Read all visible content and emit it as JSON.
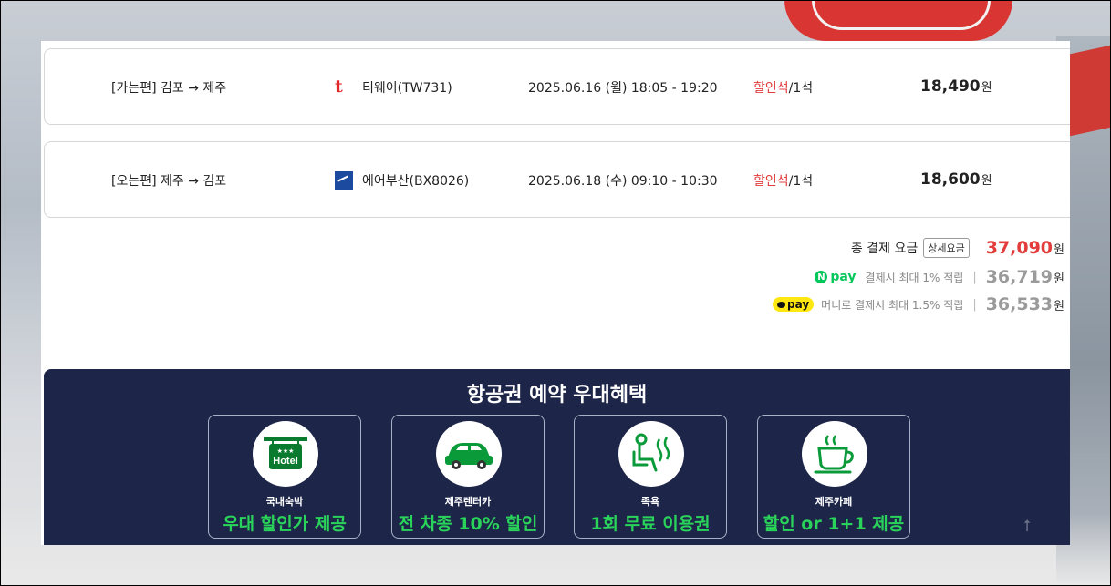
{
  "flights": [
    {
      "route": "[가는편] 김포 → 제주",
      "airline_logo": "tway-logo-icon",
      "airline_logo_text": "t",
      "airline": "티웨이(TW731)",
      "datetime": "2025.06.16 (월) 18:05 - 19:20",
      "seat_type": "할인석",
      "seat_count": "/1석",
      "price": "18,490",
      "currency": "원"
    },
    {
      "route": "[오는편] 제주 → 김포",
      "airline_logo": "airbusan-logo-icon",
      "airline": "에어부산(BX8026)",
      "datetime": "2025.06.18 (수) 09:10 - 10:30",
      "seat_type": "할인석",
      "seat_count": "/1석",
      "price": "18,600",
      "currency": "원"
    }
  ],
  "summary": {
    "total_label": "총 결제 요금",
    "detail_button": "상세요금",
    "total_amount": "37,090",
    "currency": "원",
    "npay_logo_n": "N",
    "npay_logo_text": "pay",
    "npay_text": "결제시 최대 1% 적립",
    "npay_amount": "36,719",
    "kakaopay_logo_text": "pay",
    "kakaopay_text": "머니로 결제시 최대 1.5% 적립",
    "kakaopay_amount": "36,533",
    "separator": "|"
  },
  "benefits": {
    "title": "항공권 예약 우대혜택",
    "cards": [
      {
        "icon": "hotel-icon",
        "icon_text": "Hotel",
        "caption": "국내숙박",
        "headline": "우대 할인가 제공"
      },
      {
        "icon": "car-icon",
        "caption": "제주렌터카",
        "headline": "전 차종 10% 할인"
      },
      {
        "icon": "foot-spa-icon",
        "caption": "족욕",
        "headline": "1회 무료 이용권"
      },
      {
        "icon": "coffee-cup-icon",
        "caption": "제주카페",
        "headline": "할인 or 1+1 제공"
      }
    ]
  },
  "colors": {
    "accent_red": "#e23c3c",
    "benefit_bg": "#1d2548",
    "benefit_green": "#2ad35a",
    "npay_green": "#03c75a",
    "kakao_yellow": "#ffe812"
  },
  "scroll_top_icon": "arrow-up-icon",
  "scroll_top_glyph": "⭡"
}
